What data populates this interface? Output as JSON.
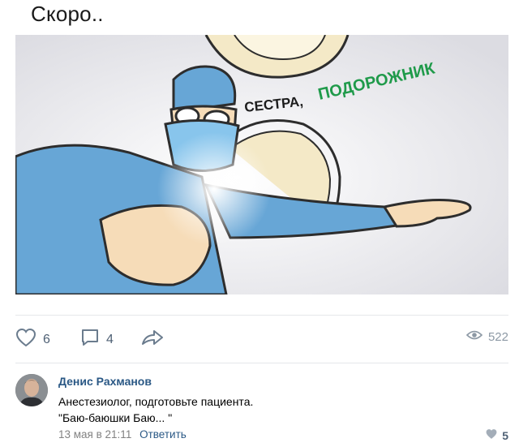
{
  "post": {
    "text": "Скоро..",
    "image_caption_1": "СЕСТРА,",
    "image_caption_2": "ПОДОРОЖНИК"
  },
  "actions": {
    "likes": "6",
    "comments": "4",
    "views": "522"
  },
  "comment": {
    "author": "Денис Рахманов",
    "line1": "Анестезиолог, подготовьте пациента.",
    "line2": "\"Баю-баюшки Баю... \"",
    "date": "13 мая в 21:11",
    "reply": "Ответить",
    "likes": "5"
  },
  "colors": {
    "link": "#2a5885",
    "icon": "#6b7c8e",
    "muted": "#828282"
  }
}
